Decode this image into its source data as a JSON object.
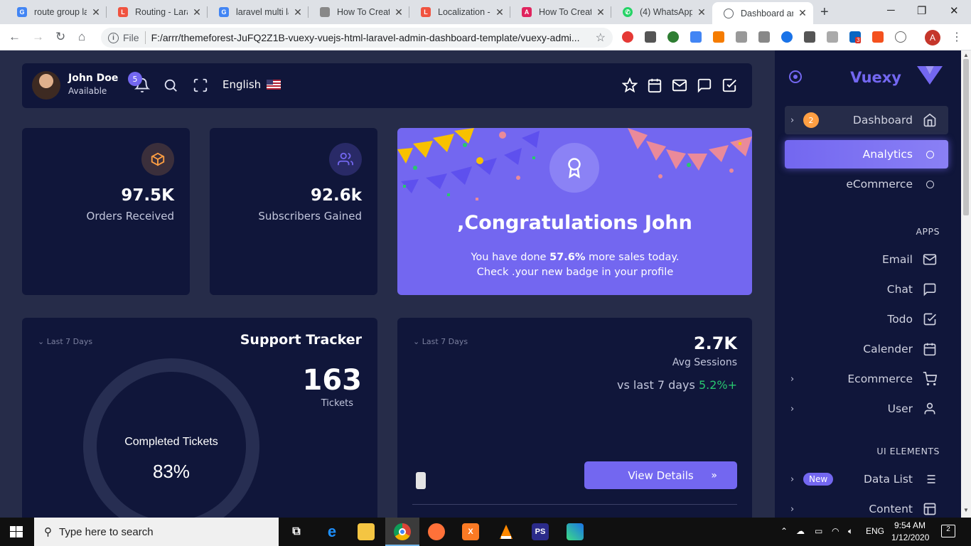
{
  "browser": {
    "tabs": [
      {
        "title": "route group la",
        "icon": "google-icon",
        "color": "#4285f4"
      },
      {
        "title": "Routing - Lara",
        "icon": "laravel-icon",
        "color": "#f05340"
      },
      {
        "title": "laravel multi la",
        "icon": "google-icon",
        "color": "#4285f4"
      },
      {
        "title": "How To Create",
        "icon": "page-icon",
        "color": "#888888"
      },
      {
        "title": "Localization - L",
        "icon": "laravel-icon",
        "color": "#f05340"
      },
      {
        "title": "How To Create",
        "icon": "app-icon",
        "color": "#e0245e"
      },
      {
        "title": "(4) WhatsApp",
        "icon": "whatsapp-icon",
        "color": "#25d366"
      },
      {
        "title": "Dashboard an",
        "icon": "globe-icon",
        "color": "#5f6368"
      }
    ],
    "omnibox": {
      "scheme_label": "File",
      "url": "F:/arrr/themeforest-JuFQ2Z1B-vuexy-vuejs-html-laravel-admin-dashboard-template/vuexy-admi..."
    },
    "profile_initial": "A",
    "ext_badge": "3"
  },
  "navbar": {
    "user_name": "John Doe",
    "user_status": "Available",
    "notifications_count": "5",
    "language": "English"
  },
  "stats": [
    {
      "value": "97.5K",
      "label": "Orders Received",
      "icon": "box-icon",
      "color": "#ff9f43"
    },
    {
      "value": "92.6k",
      "label": "Subscribers Gained",
      "icon": "users-icon",
      "color": "#7367f0"
    }
  ],
  "congrats": {
    "title": ",Congratulations John",
    "text_before": "You have done ",
    "text_highlight": "57.6%",
    "text_after": " more sales today. Check .your new badge in your profile"
  },
  "support": {
    "period": "Last 7 Days",
    "title": "Support Tracker",
    "tickets_value": "163",
    "tickets_label": "Tickets",
    "completed_label": "Completed Tickets",
    "completed_value": "83%"
  },
  "sessions": {
    "period": "Last 7 Days",
    "value": "2.7K",
    "label": "Avg Sessions",
    "vs_text": "vs last 7 days ",
    "vs_pct": "5.2%+",
    "button": "View Details"
  },
  "sidebar": {
    "brand": "Vuexy",
    "dashboard": {
      "label": "Dashboard",
      "badge": "2"
    },
    "analytics": "Analytics",
    "ecommerce_sub": "eCommerce",
    "apps_header": "APPS",
    "apps": [
      {
        "label": "Email",
        "icon": "mail-icon"
      },
      {
        "label": "Chat",
        "icon": "chat-icon"
      },
      {
        "label": "Todo",
        "icon": "check-square-icon"
      },
      {
        "label": "Calender",
        "icon": "calendar-icon"
      },
      {
        "label": "Ecommerce",
        "icon": "cart-icon"
      },
      {
        "label": "User",
        "icon": "user-icon"
      }
    ],
    "ui_header": "UI ELEMENTS",
    "ui": [
      {
        "label": "Data List",
        "icon": "list-icon",
        "badge": "New"
      },
      {
        "label": "Content",
        "icon": "layout-icon"
      }
    ]
  },
  "taskbar": {
    "search_placeholder": "Type here to search",
    "lang": "ENG",
    "time": "9:54 AM",
    "date": "1/12/2020",
    "notif_count": "2"
  }
}
